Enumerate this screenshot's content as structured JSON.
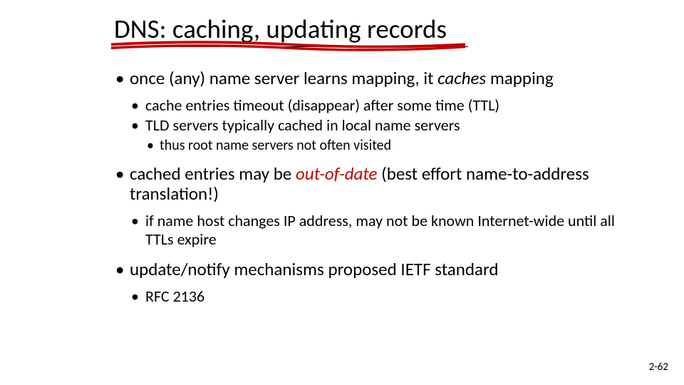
{
  "title": "DNS: caching, updating records",
  "bullets": {
    "b1_pre": "once (any) name server learns mapping, it ",
    "b1_em": "caches",
    "b1_post": " mapping",
    "b1a": "cache entries timeout (disappear) after some time (TTL)",
    "b1b": "TLD servers typically cached in local name servers",
    "b1b1": "thus root name servers not often visited",
    "b2_pre": "cached entries may be ",
    "b2_em": "out-of-date",
    "b2_post": " (best effort name-to-address translation!)",
    "b2a": "if name host changes IP address, may not be known Internet-wide until all TTLs expire",
    "b3": "update/notify mechanisms proposed IETF standard",
    "b3a": "RFC 2136"
  },
  "pagenum": "2-62"
}
